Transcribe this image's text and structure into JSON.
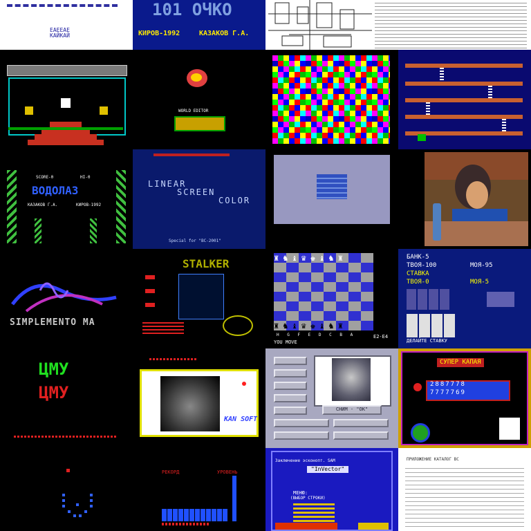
{
  "tiles": {
    "r1c1": {
      "bottom_text": "ЕАЕЕАЕ\nКАЙКАЙ"
    },
    "r1c2": {
      "big_title": "101 ОЧКО",
      "author_year": "КИРОВ-1992",
      "author": "КАЗАКОВ Г.А."
    },
    "r1c3": {
      "doc_text": "Схема вида принципиальная ..."
    },
    "r2c2": {
      "caption": "WORLD EDITOR"
    },
    "r3c1": {
      "score_left": "SCORE-0",
      "score_right": "HI-0",
      "title": "ВОДОЛАЗ",
      "author": "КАЗАКОВ Г.А.",
      "city_year": "КИРОВ-1992"
    },
    "r3c2": {
      "line1": "LINEAR",
      "line2": "SCREEN",
      "line3": "COLOR",
      "bottom": "Special for \"ВС-2001\""
    },
    "r4c1": {
      "bottom": "SIMPLEMENTO MA"
    },
    "r4c2": {
      "title": "STALKER"
    },
    "r4c3": {
      "status": "YOU MOVE",
      "files": "H G F E D C B A",
      "move": "E2-E4"
    },
    "r4c4": {
      "bank": "БАНК-5",
      "yours": "ТВОЯ-100",
      "mine": "МОЯ-95",
      "stake": "СТАВКА",
      "yours2": "ТВОЯ-0",
      "mine2": "МОЯ-5",
      "hint": "ДЕЛАЙТЕ СТАВКУ"
    },
    "r5c1": {
      "line1": "ЦМУ",
      "line2": "ЦМУ"
    },
    "r5c2": {
      "brand": "KAN SOFT"
    },
    "r5c3": {
      "photo_caption": "СНИМ - \"ОК\""
    },
    "r5c4": {
      "title": "СУПЕР КАПАЯ",
      "display_top": "2887778",
      "display_bottom": "7777769"
    },
    "r6c2": {
      "score_label": "РЕКОРД",
      "level_label": "УРОВЕНЬ"
    },
    "r6c3": {
      "header": "Заключение эсконопт. SAM",
      "box_title": "\"InVector\"",
      "menu_title": "МЕНЮ:",
      "menu_sub": "(ВЫБОР СТРОКИ)"
    },
    "r6c4": {
      "doc_title": "ПРИЛОЖЕНИЕ КАТАЛОГ ВС"
    }
  }
}
